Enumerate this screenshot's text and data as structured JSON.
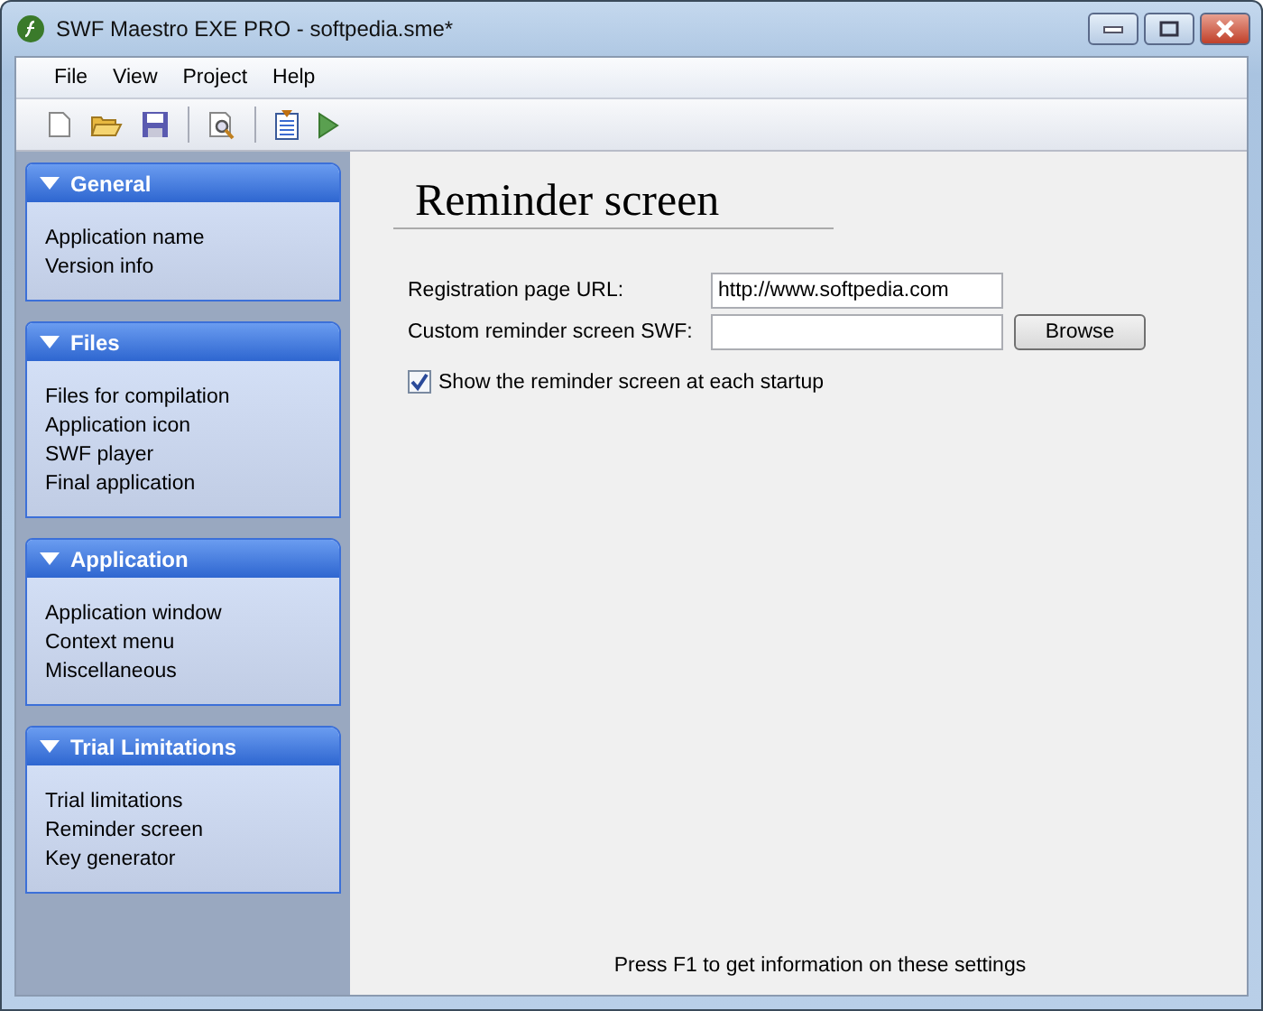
{
  "window": {
    "title": "SWF Maestro EXE PRO - softpedia.sme*"
  },
  "menu": [
    "File",
    "View",
    "Project",
    "Help"
  ],
  "sidebar": {
    "groups": [
      {
        "title": "General",
        "expanded": true,
        "items": [
          "Application name",
          "Version info"
        ]
      },
      {
        "title": "Files",
        "expanded": true,
        "items": [
          "Files for compilation",
          "Application icon",
          "SWF player",
          "Final application"
        ]
      },
      {
        "title": "Application",
        "expanded": true,
        "items": [
          "Application window",
          "Context menu",
          "Miscellaneous"
        ]
      },
      {
        "title": "Trial Limitations",
        "expanded": true,
        "items": [
          "Trial limitations",
          "Reminder screen",
          "Key generator"
        ]
      }
    ]
  },
  "page": {
    "heading": "Reminder screen",
    "fields": [
      {
        "kind": "text",
        "label": "Registration page URL:",
        "value": "http://www.softpedia.com"
      },
      {
        "kind": "file",
        "label": "Custom reminder screen SWF:",
        "button": "Browse"
      }
    ],
    "checkbox": {
      "label": "Show the reminder screen at each startup",
      "checked": true
    },
    "hint": "Press F1 to get information on these settings"
  }
}
